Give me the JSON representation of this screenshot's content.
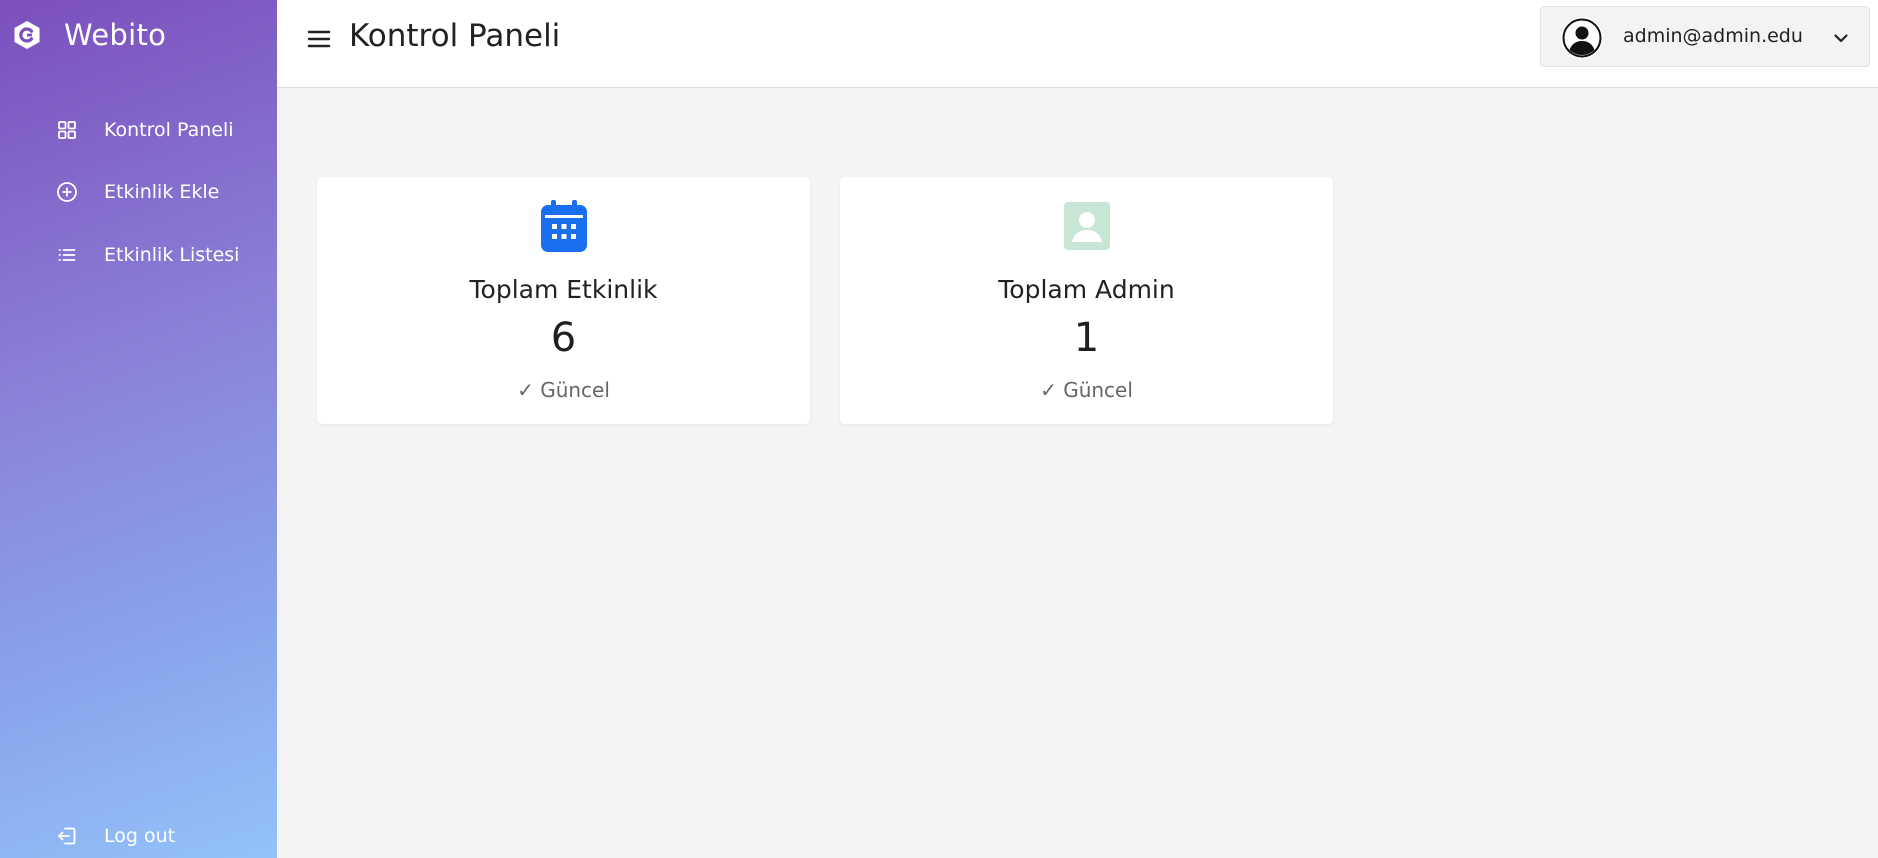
{
  "colors": {
    "sidebar_gradient_start": "#7b4fbd",
    "sidebar_gradient_end": "#93c2fa",
    "calendar_icon": "#1a6ff0",
    "admin_icon": "#c8e6d6",
    "background": "#f4f4f4"
  },
  "sidebar": {
    "brand": {
      "name": "Webito",
      "icon": "brand-logo-icon"
    },
    "items": [
      {
        "label": "Kontrol Paneli",
        "icon": "grid-icon"
      },
      {
        "label": "Etkinlik Ekle",
        "icon": "plus-circle-icon"
      },
      {
        "label": "Etkinlik Listesi",
        "icon": "list-icon"
      }
    ],
    "logout": {
      "label": "Log out",
      "icon": "logout-icon"
    }
  },
  "header": {
    "menu_icon": "hamburger-icon",
    "title": "Kontrol Paneli",
    "user": {
      "email": "admin@admin.edu",
      "avatar_icon": "user-avatar-icon",
      "chevron_icon": "chevron-down-icon"
    }
  },
  "cards": [
    {
      "title": "Toplam Etkinlik",
      "value": "6",
      "status": "✓ Güncel",
      "icon": "calendar-icon"
    },
    {
      "title": "Toplam Admin",
      "value": "1",
      "status": "✓ Güncel",
      "icon": "user-badge-icon"
    }
  ]
}
